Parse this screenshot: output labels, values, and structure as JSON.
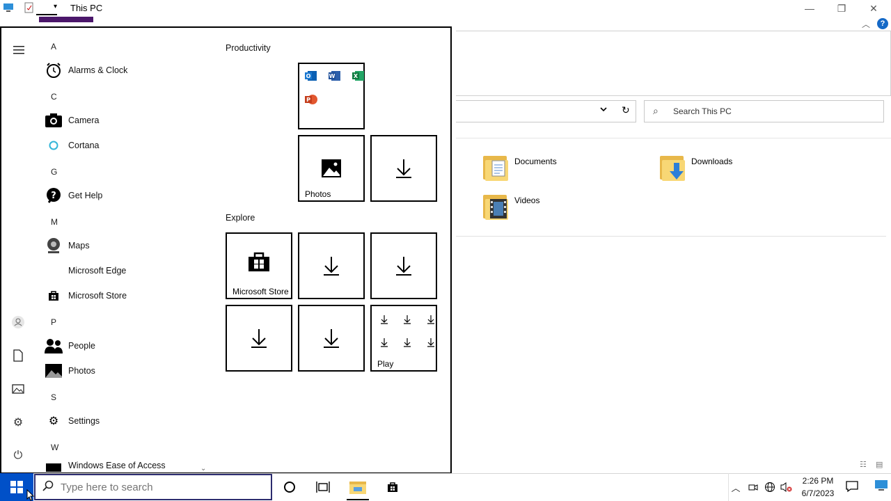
{
  "explorer": {
    "title": "This PC",
    "search_placeholder": "Search This PC",
    "folders": [
      {
        "label": "Documents"
      },
      {
        "label": "Downloads"
      },
      {
        "label": "Videos"
      }
    ]
  },
  "start_menu": {
    "sections": [
      {
        "letter": "A",
        "apps": [
          "Alarms & Clock"
        ]
      },
      {
        "letter": "C",
        "apps": [
          "Camera",
          "Cortana"
        ]
      },
      {
        "letter": "G",
        "apps": [
          "Get Help"
        ]
      },
      {
        "letter": "M",
        "apps": [
          "Maps",
          "Microsoft Edge",
          "Microsoft Store"
        ]
      },
      {
        "letter": "P",
        "apps": [
          "People",
          "Photos"
        ]
      },
      {
        "letter": "S",
        "apps": [
          "Settings"
        ]
      },
      {
        "letter": "W",
        "apps": [
          "Windows Ease of Access"
        ]
      }
    ],
    "groups": {
      "productivity": "Productivity",
      "explore": "Explore"
    },
    "tiles": {
      "photos": "Photos",
      "store": "Microsoft Store",
      "play": "Play"
    }
  },
  "taskbar": {
    "search_placeholder": "Type here to search",
    "time": "2:26 PM",
    "date": "6/7/2023"
  },
  "colors": {
    "start_button": "#0050c8",
    "ribbon_accent": "#4b176b",
    "help": "#1569c7"
  }
}
